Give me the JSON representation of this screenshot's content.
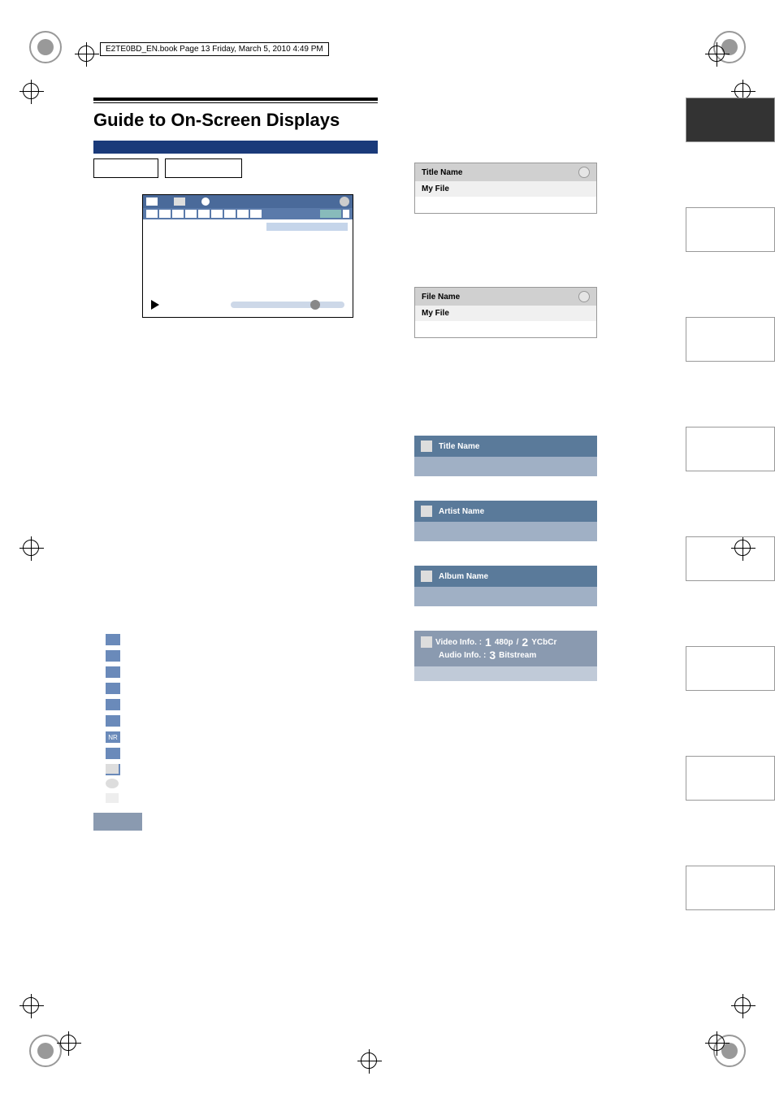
{
  "header": "E2TE0BD_EN.book  Page 13  Friday, March 5, 2010  4:49 PM",
  "title": "Guide to On-Screen Displays",
  "panel1": {
    "head": "Title Name",
    "sub": "My File"
  },
  "panel2": {
    "head": "File Name",
    "sub": "My File"
  },
  "bar1": "Title Name",
  "bar2": "Artist Name",
  "bar3": "Album Name",
  "video": {
    "l1": "Video Info.  :",
    "n1": "1",
    "v1": "480p",
    "sep": "/",
    "n2": "2",
    "v2": "YCbCr",
    "l2": "Audio Info.  :",
    "n3": "3",
    "v3": "Bitstream"
  }
}
